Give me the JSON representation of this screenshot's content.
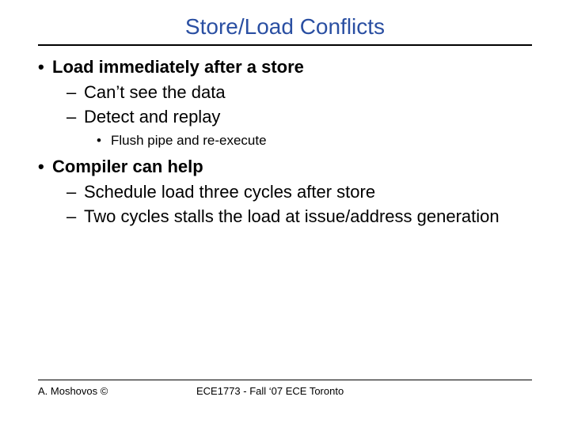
{
  "title": "Store/Load Conflicts",
  "bullets": {
    "b1": "Load immediately after a store",
    "b1a": "Can’t see the data",
    "b1b": "Detect and replay",
    "b1b1": "Flush pipe and re-execute",
    "b2": "Compiler can help",
    "b2a": "Schedule load three cycles after store",
    "b2b": "Two cycles stalls the load at issue/address generation"
  },
  "footer": {
    "left": "A. Moshovos ©",
    "center": "ECE1773 - Fall ‘07 ECE Toronto"
  }
}
